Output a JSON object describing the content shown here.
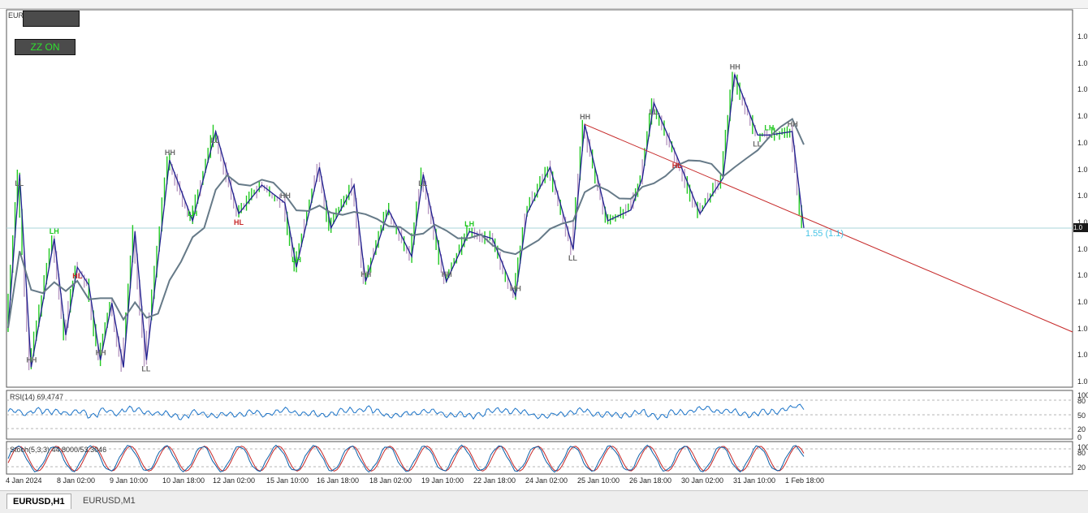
{
  "window": {
    "title": "EURUSD,H1"
  },
  "buttons": {
    "button_1": "",
    "zigzag": "ZZ ON"
  },
  "fib_label": "1.55 (1.1)",
  "price_badge": "1.0",
  "indicators": {
    "rsi": {
      "label": "RSI(14) 69.4747",
      "levels": [
        "100",
        "80",
        "50",
        "20",
        "0"
      ]
    },
    "stoch": {
      "label": "Stoch(5,3,3) 44.8000/53.3046",
      "levels": [
        "100",
        "80",
        "20"
      ]
    }
  },
  "tabs": [
    {
      "label": "EURUSD,H1",
      "active": true
    },
    {
      "label": "EURUSD,M1",
      "active": false
    }
  ],
  "colors": {
    "bull": "#22c922",
    "bear": "#b89ac2",
    "zigzag": "#1f1f8f",
    "ma": "#667a88",
    "trendline": "#c62828",
    "rsi": "#1a73c8",
    "stoch_main": "#0b5fa8",
    "stoch_signal": "#c62828"
  },
  "chart_data": {
    "type": "candlestick",
    "x_ticks": [
      "4 Jan 2024",
      "8 Jan 02:00",
      "9 Jan 10:00",
      "10 Jan 18:00",
      "12 Jan 02:00",
      "15 Jan 10:00",
      "16 Jan 18:00",
      "18 Jan 02:00",
      "19 Jan 10:00",
      "22 Jan 18:00",
      "24 Jan 02:00",
      "25 Jan 10:00",
      "26 Jan 18:00",
      "30 Jan 02:00",
      "31 Jan 10:00",
      "1 Feb 18:00"
    ],
    "y_ticks": [
      "1.0",
      "1.0",
      "1.0",
      "1.0",
      "1.0",
      "1.0",
      "1.0",
      "1.0",
      "1.0",
      "1.0",
      "1.0",
      "1.0",
      "1.0",
      "1.0"
    ],
    "zigzag": [
      [
        0,
        0.15
      ],
      [
        1,
        0.58
      ],
      [
        2,
        0.04
      ],
      [
        4,
        0.4
      ],
      [
        5,
        0.13
      ],
      [
        6,
        0.32
      ],
      [
        7,
        0.27
      ],
      [
        8,
        0.06
      ],
      [
        9,
        0.22
      ],
      [
        10,
        0.04
      ],
      [
        11,
        0.42
      ],
      [
        12,
        0.06
      ],
      [
        14,
        0.62
      ],
      [
        16,
        0.45
      ],
      [
        18,
        0.7
      ],
      [
        20,
        0.47
      ],
      [
        22,
        0.55
      ],
      [
        24,
        0.5
      ],
      [
        25,
        0.32
      ],
      [
        27,
        0.6
      ],
      [
        28,
        0.43
      ],
      [
        30,
        0.55
      ],
      [
        31,
        0.28
      ],
      [
        33,
        0.48
      ],
      [
        35,
        0.35
      ],
      [
        36,
        0.58
      ],
      [
        38,
        0.28
      ],
      [
        40,
        0.42
      ],
      [
        42,
        0.4
      ],
      [
        44,
        0.24
      ],
      [
        45,
        0.47
      ],
      [
        47,
        0.6
      ],
      [
        49,
        0.37
      ],
      [
        50,
        0.72
      ],
      [
        52,
        0.45
      ],
      [
        54,
        0.48
      ],
      [
        55,
        0.57
      ],
      [
        56,
        0.78
      ],
      [
        58,
        0.63
      ],
      [
        60,
        0.47
      ],
      [
        62,
        0.57
      ],
      [
        63,
        0.86
      ],
      [
        65,
        0.69
      ],
      [
        66,
        0.69
      ],
      [
        68,
        0.7
      ],
      [
        69,
        0.43
      ]
    ],
    "labels": [
      {
        "i": 2,
        "t": "HH",
        "above": true
      },
      {
        "i": 4,
        "t": "LH",
        "above": true
      },
      {
        "i": 1,
        "t": "LL",
        "above": false
      },
      {
        "i": 8,
        "t": "HH",
        "above": true
      },
      {
        "i": 6,
        "t": "HL",
        "above": false
      },
      {
        "i": 12,
        "t": "LL",
        "above": false
      },
      {
        "i": 14,
        "t": "HH",
        "above": true
      },
      {
        "i": 16,
        "t": "LH",
        "above": true
      },
      {
        "i": 18,
        "t": "LL",
        "above": false
      },
      {
        "i": 20,
        "t": "HL",
        "above": false
      },
      {
        "i": 24,
        "t": "HH",
        "above": true
      },
      {
        "i": 25,
        "t": "LH",
        "above": true
      },
      {
        "i": 31,
        "t": "HH",
        "above": true
      },
      {
        "i": 36,
        "t": "LL",
        "above": false
      },
      {
        "i": 38,
        "t": "HH",
        "above": true
      },
      {
        "i": 40,
        "t": "LH",
        "above": true
      },
      {
        "i": 44,
        "t": "HH",
        "above": true
      },
      {
        "i": 49,
        "t": "LL",
        "above": false
      },
      {
        "i": 50,
        "t": "HH",
        "above": true
      },
      {
        "i": 56,
        "t": "LL",
        "above": false
      },
      {
        "i": 58,
        "t": "HL",
        "above": false
      },
      {
        "i": 63,
        "t": "HH",
        "above": true
      },
      {
        "i": 65,
        "t": "LL",
        "above": false
      },
      {
        "i": 66,
        "t": "LH",
        "above": true
      },
      {
        "i": 68,
        "t": "HH",
        "above": true
      }
    ],
    "rsi_values": [
      56,
      52,
      60,
      54,
      58,
      51,
      55,
      48,
      57,
      53,
      62,
      58,
      55,
      50,
      47,
      44,
      52,
      50,
      46,
      48,
      51,
      53,
      49,
      55,
      58,
      54,
      50,
      47,
      52,
      56,
      60,
      63,
      55,
      48,
      46,
      52,
      57,
      54,
      50,
      48,
      45,
      51,
      56,
      60,
      58,
      52,
      47,
      44,
      50,
      55,
      57,
      52,
      49,
      46,
      50,
      53,
      48,
      45,
      52,
      56,
      60,
      63,
      58,
      55,
      52,
      49,
      54,
      58,
      62,
      69
    ]
  }
}
